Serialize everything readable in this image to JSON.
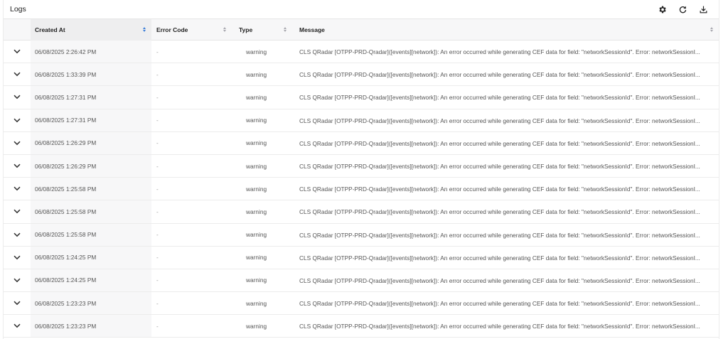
{
  "header": {
    "title": "Logs",
    "icons": [
      "gear-icon",
      "refresh-icon",
      "download-icon"
    ]
  },
  "table": {
    "columns": [
      {
        "key": "created_at",
        "label": "Created At",
        "sort": "active"
      },
      {
        "key": "error_code",
        "label": "Error Code",
        "sort": "none"
      },
      {
        "key": "type",
        "label": "Type",
        "sort": "none"
      },
      {
        "key": "message",
        "label": "Message",
        "sort": "none"
      }
    ],
    "rows": [
      {
        "created_at": "06/08/2025 2:26:42 PM",
        "error_code": "-",
        "type": "warning",
        "message": "CLS QRadar [OTPP-PRD-Qradar]([events][network]): An error occurred while generating CEF data for field: \"networkSessionId\". Error: networkSessionI..."
      },
      {
        "created_at": "06/08/2025 1:33:39 PM",
        "error_code": "-",
        "type": "warning",
        "message": "CLS QRadar [OTPP-PRD-Qradar]([events][network]): An error occurred while generating CEF data for field: \"networkSessionId\". Error: networkSessionI..."
      },
      {
        "created_at": "06/08/2025 1:27:31 PM",
        "error_code": "-",
        "type": "warning",
        "message": "CLS QRadar [OTPP-PRD-Qradar]([events][network]): An error occurred while generating CEF data for field: \"networkSessionId\". Error: networkSessionI..."
      },
      {
        "created_at": "06/08/2025 1:27:31 PM",
        "error_code": "-",
        "type": "warning",
        "message": "CLS QRadar [OTPP-PRD-Qradar]([events][network]): An error occurred while generating CEF data for field: \"networkSessionId\". Error: networkSessionI..."
      },
      {
        "created_at": "06/08/2025 1:26:29 PM",
        "error_code": "-",
        "type": "warning",
        "message": "CLS QRadar [OTPP-PRD-Qradar]([events][network]): An error occurred while generating CEF data for field: \"networkSessionId\". Error: networkSessionI..."
      },
      {
        "created_at": "06/08/2025 1:26:29 PM",
        "error_code": "-",
        "type": "warning",
        "message": "CLS QRadar [OTPP-PRD-Qradar]([events][network]): An error occurred while generating CEF data for field: \"networkSessionId\". Error: networkSessionI..."
      },
      {
        "created_at": "06/08/2025 1:25:58 PM",
        "error_code": "-",
        "type": "warning",
        "message": "CLS QRadar [OTPP-PRD-Qradar]([events][network]): An error occurred while generating CEF data for field: \"networkSessionId\". Error: networkSessionI..."
      },
      {
        "created_at": "06/08/2025 1:25:58 PM",
        "error_code": "-",
        "type": "warning",
        "message": "CLS QRadar [OTPP-PRD-Qradar]([events][network]): An error occurred while generating CEF data for field: \"networkSessionId\". Error: networkSessionI..."
      },
      {
        "created_at": "06/08/2025 1:25:58 PM",
        "error_code": "-",
        "type": "warning",
        "message": "CLS QRadar [OTPP-PRD-Qradar]([events][network]): An error occurred while generating CEF data for field: \"networkSessionId\". Error: networkSessionI..."
      },
      {
        "created_at": "06/08/2025 1:24:25 PM",
        "error_code": "-",
        "type": "warning",
        "message": "CLS QRadar [OTPP-PRD-Qradar]([events][network]): An error occurred while generating CEF data for field: \"networkSessionId\". Error: networkSessionI..."
      },
      {
        "created_at": "06/08/2025 1:24:25 PM",
        "error_code": "-",
        "type": "warning",
        "message": "CLS QRadar [OTPP-PRD-Qradar]([events][network]): An error occurred while generating CEF data for field: \"networkSessionId\". Error: networkSessionI..."
      },
      {
        "created_at": "06/08/2025 1:23:23 PM",
        "error_code": "-",
        "type": "warning",
        "message": "CLS QRadar [OTPP-PRD-Qradar]([events][network]): An error occurred while generating CEF data for field: \"networkSessionId\". Error: networkSessionI..."
      },
      {
        "created_at": "06/08/2025 1:23:23 PM",
        "error_code": "-",
        "type": "warning",
        "message": "CLS QRadar [OTPP-PRD-Qradar]([events][network]): An error occurred while generating CEF data for field: \"networkSessionId\". Error: networkSessionI..."
      }
    ]
  },
  "colors": {
    "sort_active": "#3d7fd9",
    "header_bg": "#f7f7f8",
    "border": "#ececec"
  }
}
